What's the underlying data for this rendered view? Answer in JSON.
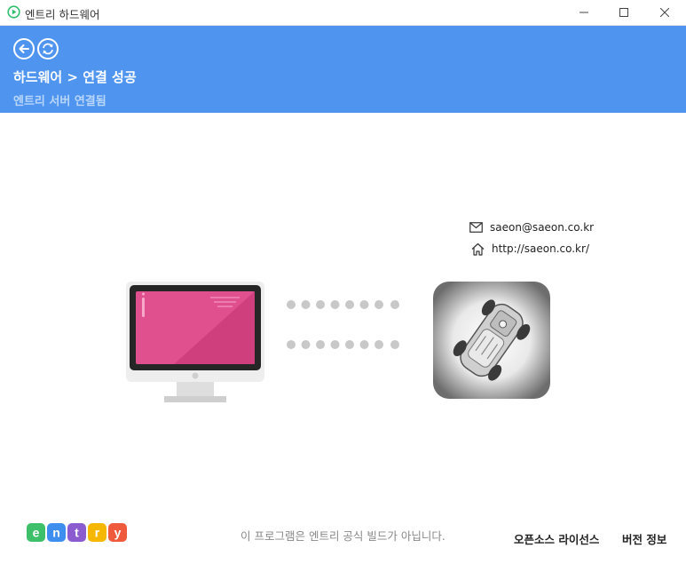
{
  "window": {
    "title": "엔트리 하드웨어",
    "controls": [
      "minimize-icon",
      "maximize-icon",
      "close-icon"
    ]
  },
  "header": {
    "back_icon": "back-arrow-icon",
    "refresh_icon": "refresh-icon",
    "breadcrumb": "하드웨어 > 연결 성공",
    "status": "엔트리 서버 연결됨"
  },
  "device": {
    "email": "saeon@saeon.co.kr",
    "website": "http://saeon.co.kr/",
    "email_icon": "mail-icon",
    "website_icon": "home-icon"
  },
  "connection": {
    "computer_icon": "monitor-icon",
    "device_image": "rc-car-image",
    "dots_per_row": 8,
    "rows": 2
  },
  "footer": {
    "logo_letters": [
      "e",
      "n",
      "t",
      "r",
      "y"
    ],
    "notice": "이 프로그램은 엔트리 공식 빌드가 아닙니다.",
    "open_source_license": "오픈소스 라이선스",
    "version_info": "버전 정보"
  },
  "colors": {
    "header_bg": "#4f95f0",
    "status_text": "#bad6fa",
    "dot": "#c8c8c8",
    "monitor_screen": "#e0508f",
    "logo": [
      "#3ec06a",
      "#3e8ef0",
      "#8b5cd0",
      "#f5b700",
      "#ef5a3c"
    ]
  }
}
